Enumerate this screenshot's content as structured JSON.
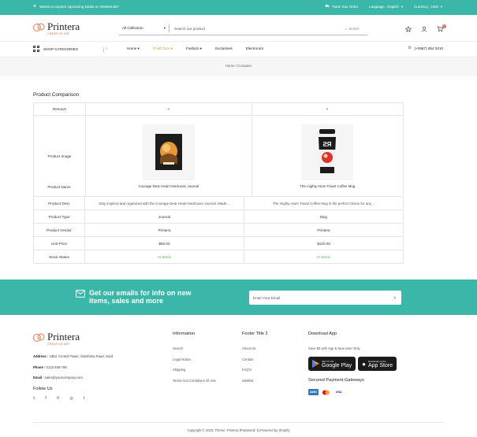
{
  "topbar": {
    "promo": "Wants to explore Upcoming Deals on Weekends?",
    "track_order": "Track Your Order",
    "language": "Language : English",
    "currency": "Currency : USD"
  },
  "brand": {
    "name": "Printera",
    "tagline": "CREATIVE ART"
  },
  "search": {
    "category": "All Collection",
    "placeholder": "Search our product",
    "button": "Search"
  },
  "cart_count": "0",
  "nav": {
    "shop_categories": "SHOP CATEGORIES",
    "items": [
      "Home",
      "Child Care",
      "Fashion",
      "Exclusives",
      "Electronics"
    ],
    "phone": "(+0987) 654 3210"
  },
  "breadcrumb": {
    "home": "Home",
    "separator": "/",
    "current": "Compare"
  },
  "comparison": {
    "title": "Product Comparison",
    "labels": {
      "remove": "Remove",
      "image": "Product Image",
      "name": "Product Name",
      "desc": "Product Desc",
      "type": "Product Type",
      "vendor": "Product Vendor",
      "price": "Unit Price",
      "stock": "Stock Status"
    },
    "remove_symbol": "×",
    "products": [
      {
        "name": "Courage Dear Heart Hardcover Journal",
        "desc": "Stay inspired and organized with the Courage Dear Heart Hardcover Journal. Made...",
        "type": "Journal",
        "vendor": "Printera",
        "price": "$50.00",
        "stock": "In Stock"
      },
      {
        "name": "The mighty Atom Travel Coffee Mug",
        "desc": "The mighty Atom Travel Coffee Mug is the perfect choice for any...",
        "type": "Mug",
        "vendor": "Printera",
        "price": "$120.00",
        "stock": "In Stock"
      }
    ]
  },
  "newsletter": {
    "heading_line1": "Get our emails for info on new",
    "heading_line2": "items, sales and more",
    "placeholder": "Enter Your Email"
  },
  "footer": {
    "address_label": "Address :",
    "address": "43bd, Central Tower, Vandhima Road, Nord",
    "phone_label": "Phone :",
    "phone": "0123-456-789",
    "email_label": "Email :",
    "email": "sales@yourcompany.com",
    "follow_us": "Follow Us",
    "information": {
      "title": "Information",
      "links": [
        "Search",
        "Legal Notice",
        "Shipping",
        "Terms And Conditions Of Use"
      ]
    },
    "footer_title_2": {
      "title": "Footer Title 2",
      "links": [
        "About Us",
        "Contact",
        "FAQ'S",
        "Wishlist"
      ]
    },
    "download_app": {
      "title": "Download App",
      "subtitle": "Save $3 with App & New User Only",
      "google_small": "GET IT ON",
      "google_big": "Google Play",
      "apple_small": "Download on the",
      "apple_big": "App Store"
    },
    "secure_title": "Secured Payment Gateways",
    "payments": [
      "AMEX",
      "MC",
      "VISA"
    ],
    "copyright": "Copyright © 2023. Theme: Printera [Password: 1] Powered by Shopify"
  },
  "colors": {
    "teal": "#3ab7a9",
    "accent": "#d8a037",
    "stock_green": "#4caf50"
  }
}
